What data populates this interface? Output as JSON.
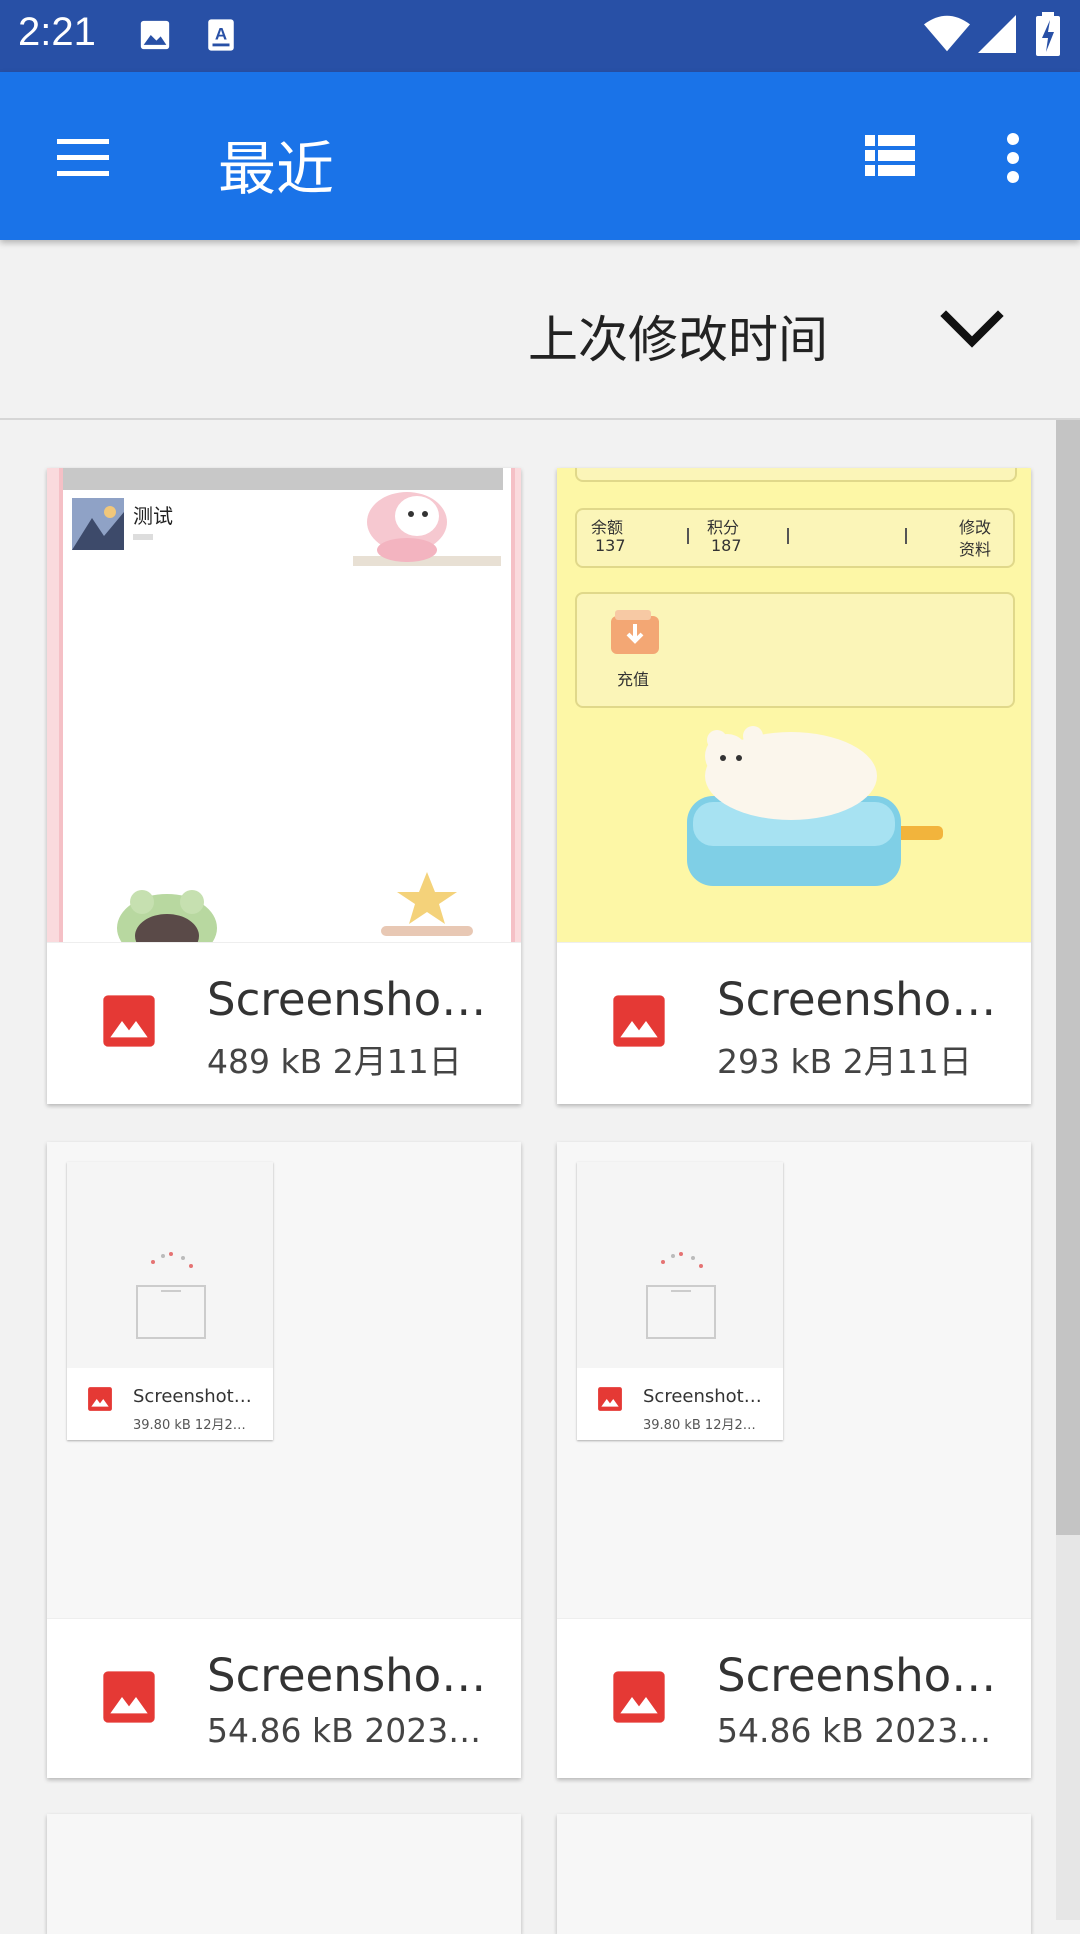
{
  "status_bar": {
    "time": "2:21"
  },
  "app_bar": {
    "title": "最近"
  },
  "sort_bar": {
    "label": "上次修改时间"
  },
  "files": [
    {
      "name": "Screenshot…",
      "meta": "489 kB 2月11日"
    },
    {
      "name": "Screenshot…",
      "meta": "293 kB 2月11日"
    },
    {
      "name": "Screenshot…",
      "meta": "54.86 kB 2023…",
      "mini": {
        "name": "Screenshot…",
        "meta": "39.80 kB 12月2…"
      }
    },
    {
      "name": "Screenshot…",
      "meta": "54.86 kB 2023…",
      "mini": {
        "name": "Screenshot…",
        "meta": "39.80 kB 12月2…"
      }
    }
  ],
  "thumb1": {
    "title": "测试"
  },
  "thumb2": {
    "balance_label": "余额",
    "balance_value": "137",
    "points_label": "积分",
    "points_value": "187",
    "edit_label_1": "修改",
    "edit_label_2": "资料",
    "recharge_label": "充值"
  },
  "colors": {
    "status_bar": "#2850a6",
    "app_bar": "#1a73e8",
    "image_icon": "#e53935"
  }
}
